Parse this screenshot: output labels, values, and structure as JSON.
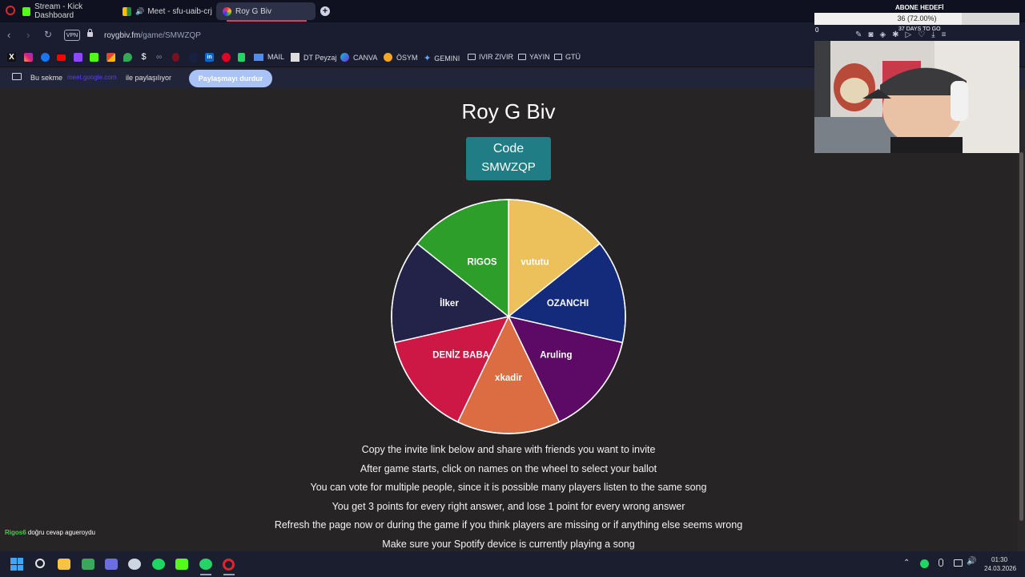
{
  "browser": {
    "tabs": [
      {
        "label": "Stream - Kick Dashboard",
        "icon": "kick-icon",
        "color": "#53fc18"
      },
      {
        "label": "Meet - sfu-uaib-crj",
        "icon": "meet-icon",
        "color": "#1e8e3e"
      },
      {
        "label": "Roy G Biv",
        "icon": "roygbiv-icon",
        "color": "#c98ad9",
        "active": true
      }
    ],
    "url_host": "roygbiv.fm",
    "url_path": "/game/SMWZQP",
    "vpn_label": "VPN",
    "bookmarks": [
      {
        "label": "MAIL",
        "icon": "mail-icon"
      },
      {
        "label": "DT Peyzaj",
        "icon": "image-icon"
      },
      {
        "label": "CANVA",
        "icon": "canva-icon"
      },
      {
        "label": "ÖSYM",
        "icon": "osym-icon"
      },
      {
        "label": "GEMINI",
        "icon": "gemini-icon"
      },
      {
        "label": "IVIR ZIVIR",
        "icon": "folder-icon"
      },
      {
        "label": "YAYIN",
        "icon": "folder-icon"
      },
      {
        "label": "GTÜ",
        "icon": "folder-icon"
      }
    ],
    "share": {
      "text_before": "Bu sekme",
      "hidden_email": "meet.google.com",
      "text_after": "ile paylaşılıyor",
      "stop_button": "Paylaşmayı durdur"
    }
  },
  "page": {
    "title": "Roy G Biv",
    "code_label": "Code",
    "code_value": "SMWZQP",
    "wheel": [
      {
        "name": "vututu",
        "color": "#ecc05a"
      },
      {
        "name": "OZANCHI",
        "color": "#132b7a"
      },
      {
        "name": "Aruling",
        "color": "#5d0a66"
      },
      {
        "name": "xkadir",
        "color": "#dc6d43"
      },
      {
        "name": "DENİZ BABA",
        "color": "#cd1745"
      },
      {
        "name": "İlker",
        "color": "#23234a"
      },
      {
        "name": "RIGOS",
        "color": "#2e9e2b"
      }
    ],
    "instructions": [
      "Copy the invite link below and share with friends you want to invite",
      "After game starts, click on names on the wheel to select your ballot",
      "You can vote for multiple people, since it is possible many players listen to the same song",
      "You get 3 points for every right answer, and lose 1 point for every wrong answer",
      "Refresh the page now or during the game if you think players are missing or if anything else seems wrong",
      "Make sure your Spotify device is currently playing a song"
    ]
  },
  "overlay": {
    "abone_title": "ABONE HEDEFİ",
    "abone_progress": "36 (72.00%)",
    "abone_fraction": 0.72,
    "abone_zero": "0",
    "abone_days": "37 DAYS TO GO",
    "chat_user": "Rigos6",
    "chat_text": "doğru cevap agueroydu"
  },
  "taskbar": {
    "time": "01:30",
    "date": "24.03.2026"
  }
}
